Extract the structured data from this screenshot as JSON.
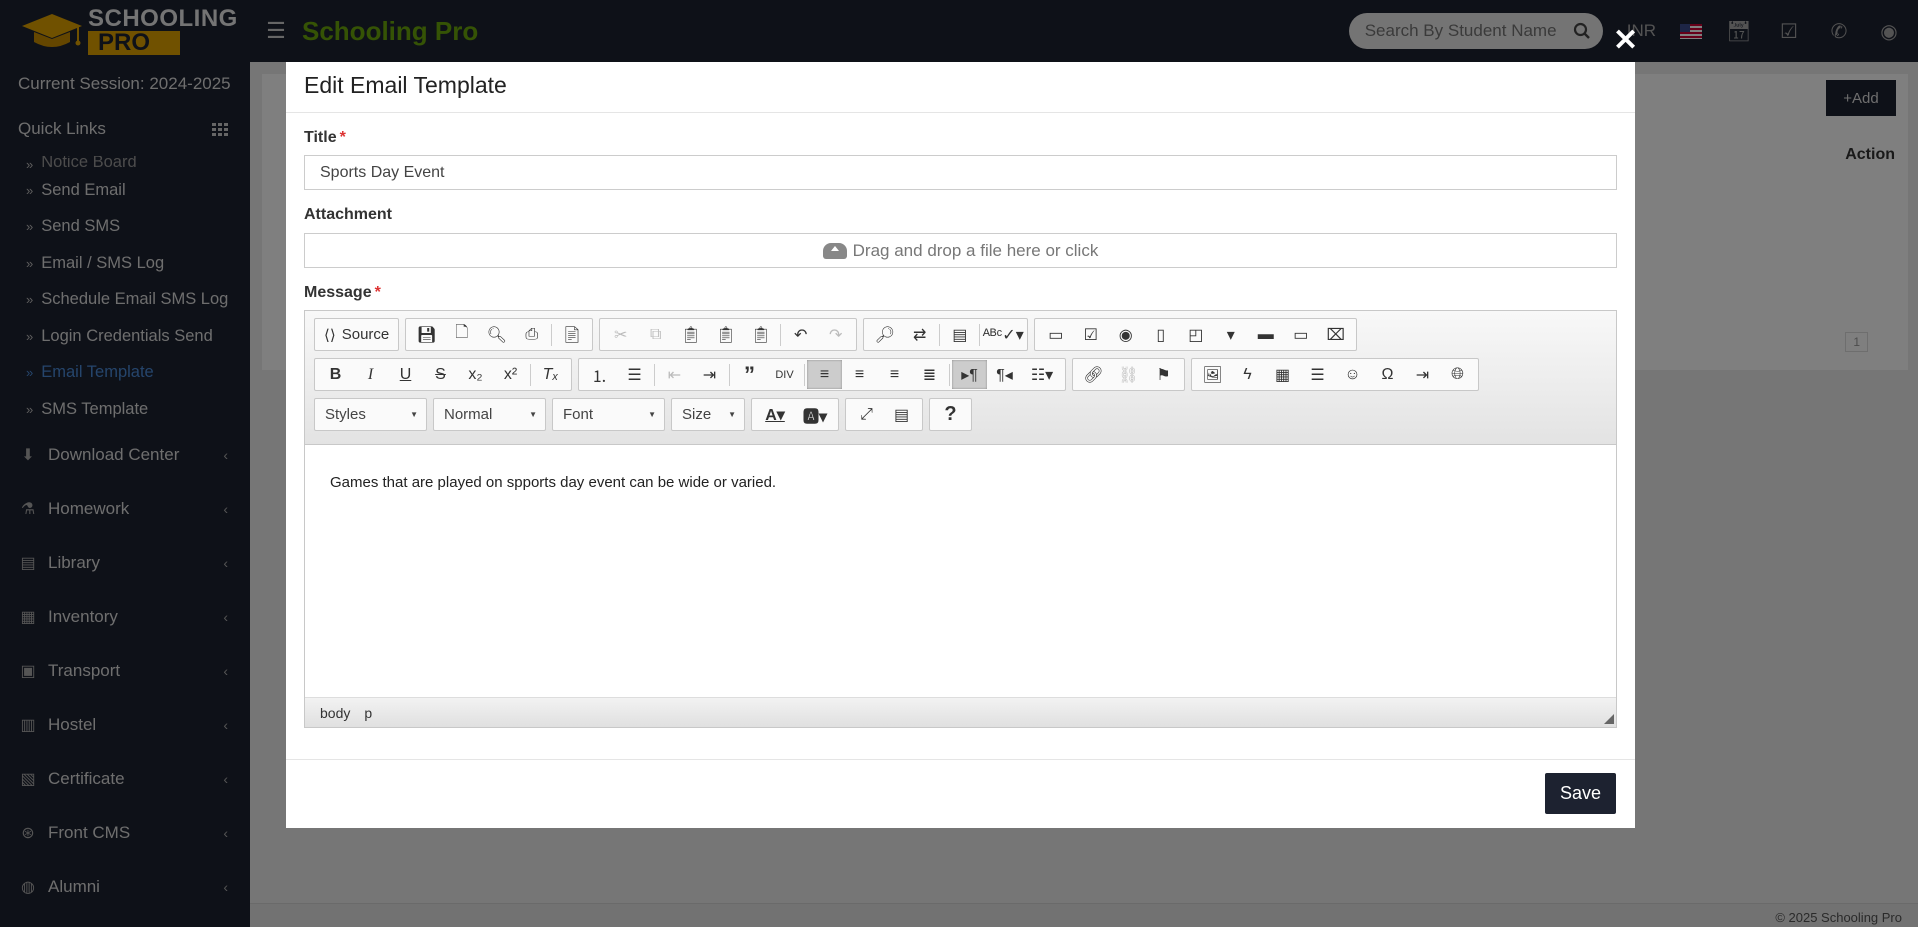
{
  "header": {
    "logo_top": "SCHOOLING",
    "logo_bottom": "PRO",
    "brand": "Schooling Pro",
    "search_placeholder": "Search By Student Name",
    "currency": "INR"
  },
  "sidebar": {
    "session": "Current Session: 2024-2025",
    "quick_links": "Quick Links",
    "sub_items": [
      {
        "label": "Notice Board"
      },
      {
        "label": "Send Email"
      },
      {
        "label": "Send SMS"
      },
      {
        "label": "Email / SMS Log"
      },
      {
        "label": "Schedule Email SMS Log"
      },
      {
        "label": "Login Credentials Send"
      },
      {
        "label": "Email Template",
        "active": true
      },
      {
        "label": "SMS Template"
      }
    ],
    "menu": [
      {
        "label": "Download Center",
        "icon": "download-icon"
      },
      {
        "label": "Homework",
        "icon": "flask-icon"
      },
      {
        "label": "Library",
        "icon": "book-icon"
      },
      {
        "label": "Inventory",
        "icon": "box-icon"
      },
      {
        "label": "Transport",
        "icon": "bus-icon"
      },
      {
        "label": "Hostel",
        "icon": "building-icon"
      },
      {
        "label": "Certificate",
        "icon": "certificate-icon"
      },
      {
        "label": "Front CMS",
        "icon": "cms-icon"
      },
      {
        "label": "Alumni",
        "icon": "alumni-icon"
      }
    ]
  },
  "page": {
    "add_label": "Add",
    "action_header": "Action",
    "pagination_current": "1"
  },
  "modal": {
    "title": "Edit Email Template",
    "title_label": "Title",
    "title_value": "Sports Day Event",
    "attachment_label": "Attachment",
    "dropzone_text": "Drag and drop a file here or click",
    "message_label": "Message",
    "editor": {
      "source_label": "Source",
      "styles": "Styles",
      "format": "Normal",
      "font": "Font",
      "size": "Size",
      "content": "Games that are played on spports day event can be wide or varied.",
      "path": [
        "body",
        "p"
      ]
    },
    "save_label": "Save"
  },
  "footer": {
    "copyright": "© 2025 Schooling Pro"
  }
}
